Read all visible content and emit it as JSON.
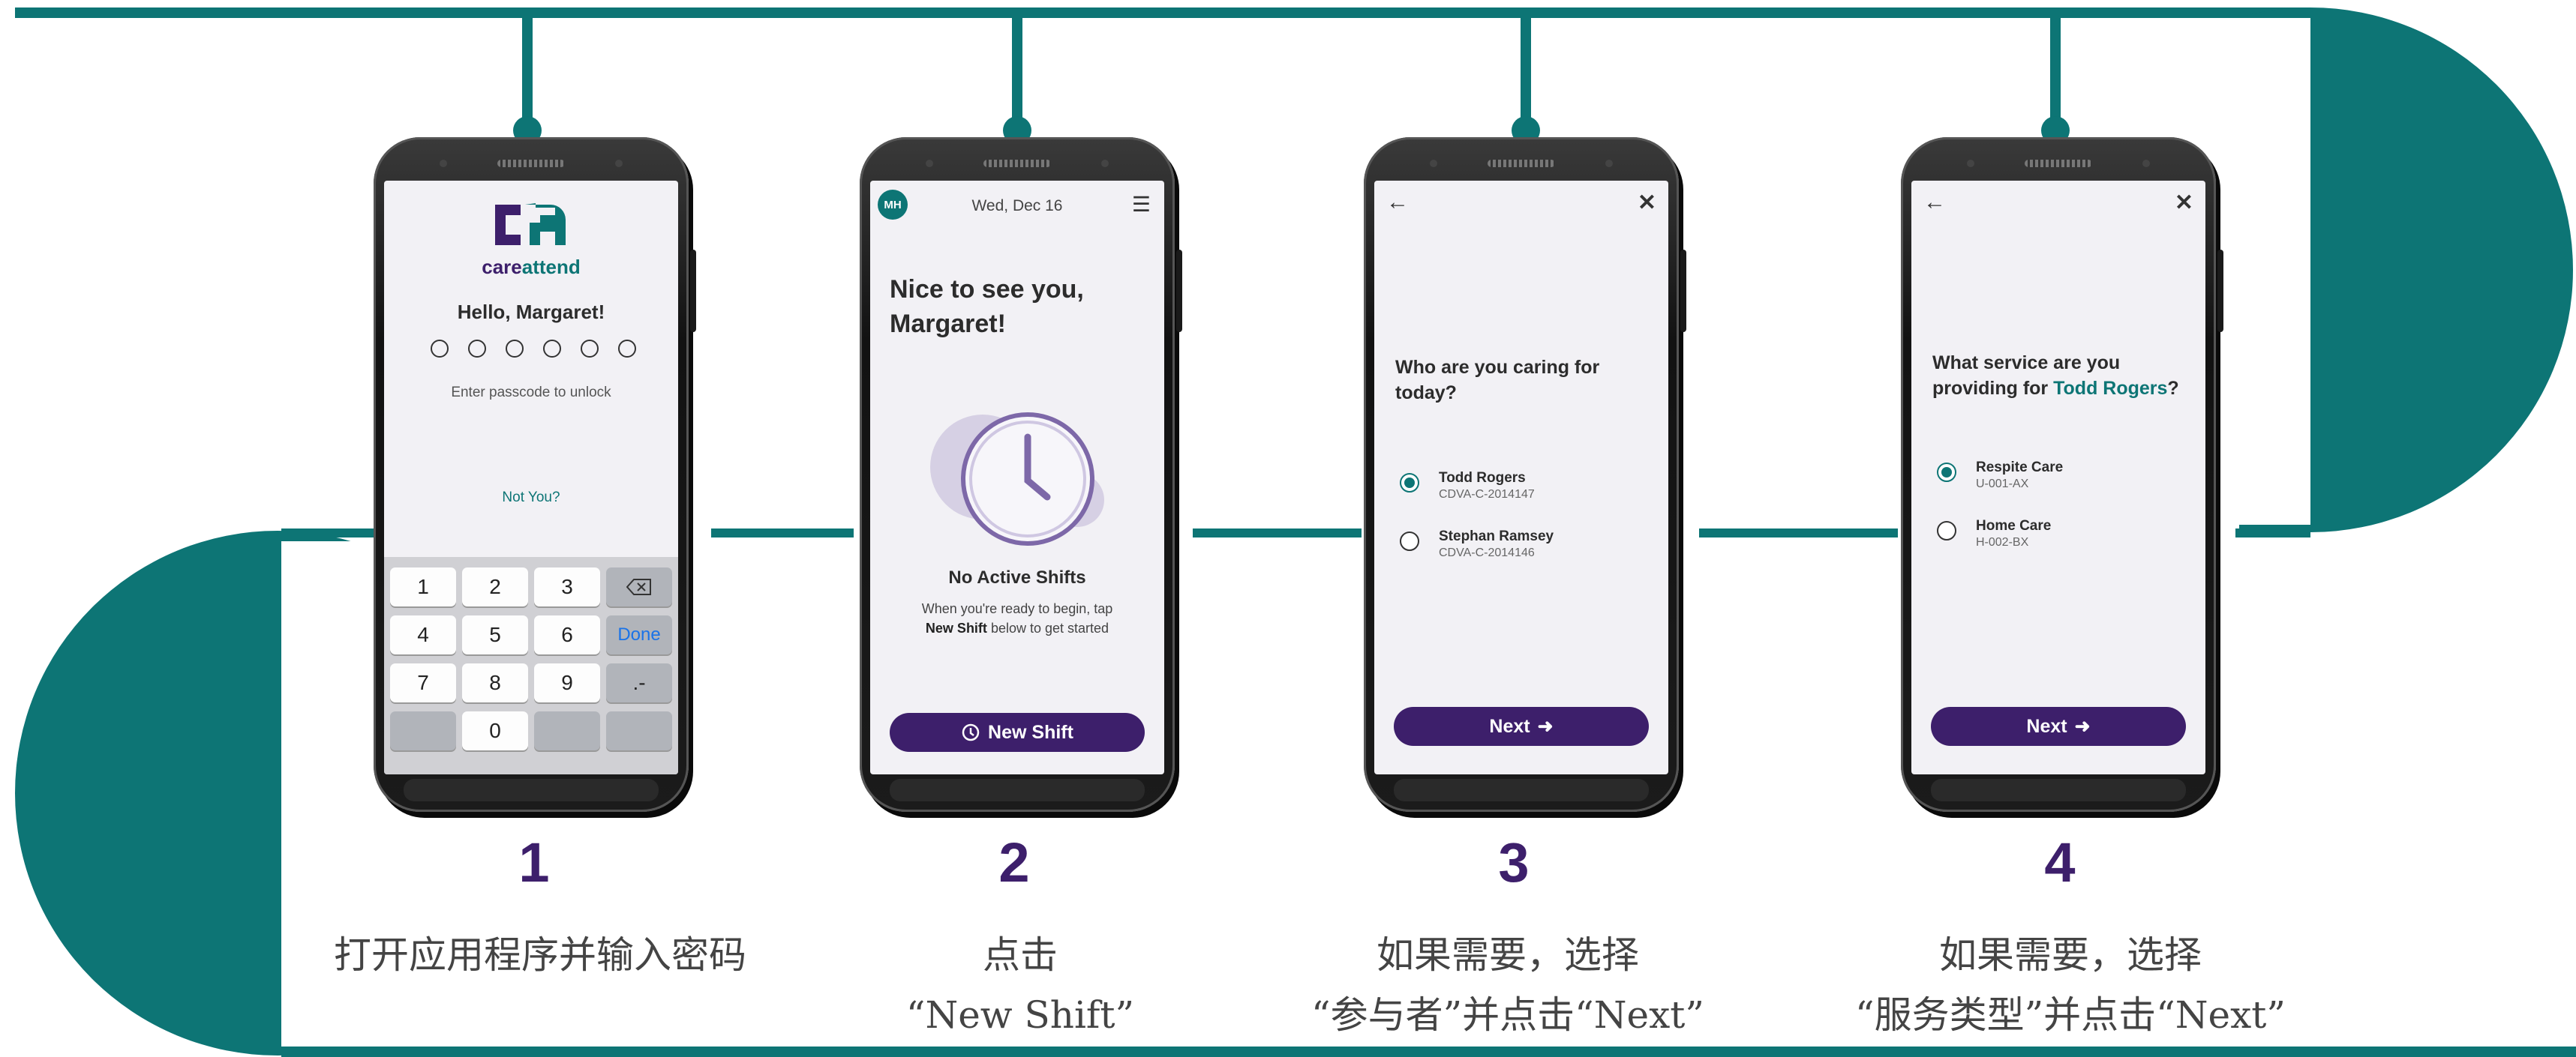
{
  "colors": {
    "teal": "#0d7575",
    "purple": "#3d1f6b",
    "screen_bg": "#f2f1f5"
  },
  "step1": {
    "brand_part1": "care",
    "brand_part2": "attend",
    "greeting": "Hello, Margaret!",
    "passcode_hint": "Enter passcode to unlock",
    "not_you": "Not You?",
    "keys": [
      "1",
      "2",
      "3",
      "4",
      "5",
      "6",
      "7",
      "8",
      "9",
      "0",
      ".-"
    ],
    "done_label": "Done",
    "backspace_icon": "backspace-icon",
    "number": "1",
    "caption_line1": "打开应用程序并输入密码"
  },
  "step2": {
    "avatar_initials": "MH",
    "date": "Wed, Dec 16",
    "greeting_line1": "Nice to see you,",
    "greeting_line2": "Margaret!",
    "status_title": "No Active Shifts",
    "status_desc_1": "When you're ready to begin, tap",
    "status_desc_bold": "New Shift",
    "status_desc_2": "below to get started",
    "button_label": "New Shift",
    "button_icon": "clock-icon",
    "number": "2",
    "caption_line1": "点击",
    "caption_line2": "“New Shift”"
  },
  "step3": {
    "question_line1": "Who are you caring for",
    "question_line2": "today?",
    "options": [
      {
        "name": "Todd Rogers",
        "id": "CDVA-C-2014147",
        "selected": true
      },
      {
        "name": "Stephan Ramsey",
        "id": "CDVA-C-2014146",
        "selected": false
      }
    ],
    "next_label": "Next",
    "number": "3",
    "caption_line1": "如果需要，选择",
    "caption_line2": "“参与者”并点击“Next”"
  },
  "step4": {
    "question_line1": "What service are you",
    "question_line2_prefix": "providing for",
    "question_highlight": "Todd Rogers",
    "question_suffix": "?",
    "options": [
      {
        "name": "Respite Care",
        "id": "U-001-AX",
        "selected": true
      },
      {
        "name": "Home Care",
        "id": "H-002-BX",
        "selected": false
      }
    ],
    "next_label": "Next",
    "number": "4",
    "caption_line1": "如果需要，选择",
    "caption_line2": "“服务类型”并点击“Next”"
  }
}
